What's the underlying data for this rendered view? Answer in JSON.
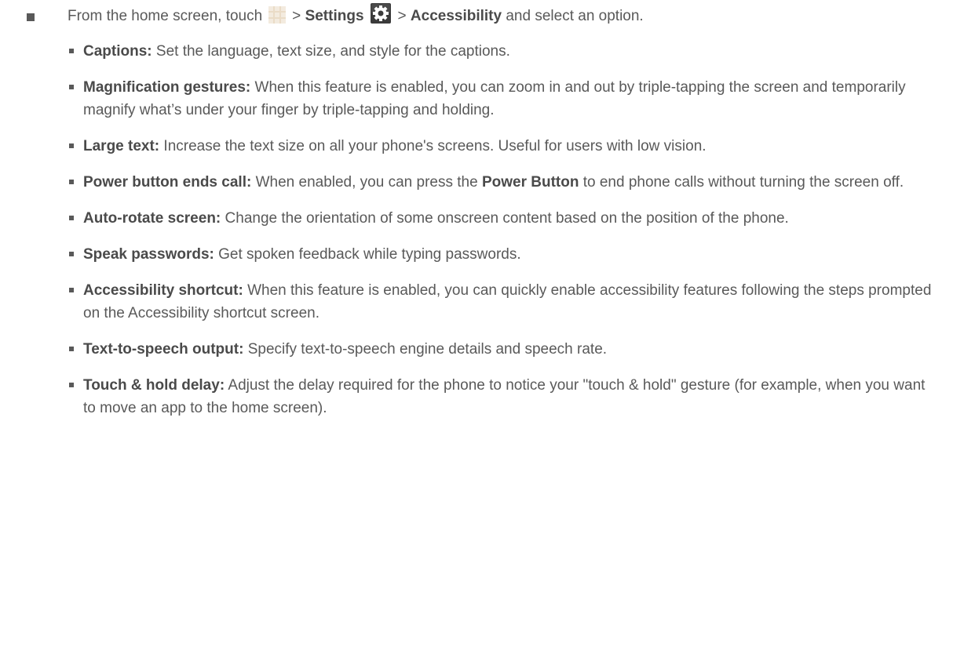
{
  "main_step": {
    "prefix": "From the home screen, touch",
    "sep1": ">",
    "settings": "Settings",
    "sep2": ">",
    "accessibility": "Accessibility",
    "suffix": "and select an option.",
    "apps_icon": "apps-grid-icon",
    "settings_icon": "gear-icon"
  },
  "items": [
    {
      "term": "Captions:",
      "desc": "Set the language, text size, and style for the captions."
    },
    {
      "term": "Magnification gestures:",
      "desc": "When this feature is enabled, you can zoom in and out by triple-tapping the screen and temporarily magnify what’s under your finger by triple-tapping and holding."
    },
    {
      "term": "Large text:",
      "desc": "Increase the text size on all your phone's screens. Useful for users with low vision."
    },
    {
      "term": "Power button ends call:",
      "desc_a": "When enabled, you can press the",
      "desc_bold": "Power Button",
      "desc_b": "to end phone calls without turning the screen off."
    },
    {
      "term": "Auto-rotate screen:",
      "desc": "Change the orientation of some onscreen content based on the position of the phone."
    },
    {
      "term": "Speak passwords:",
      "desc": "Get spoken feedback while typing passwords."
    },
    {
      "term": "Accessibility shortcut:",
      "desc": "When this feature is enabled, you can quickly enable accessibility features following the steps prompted on the Accessibility shortcut screen."
    },
    {
      "term": "Text-to-speech output:",
      "desc": "Specify text-to-speech engine details and speech rate."
    },
    {
      "term": "Touch & hold delay:",
      "desc": "Adjust the delay required for the phone to notice your \"touch & hold\" gesture (for example, when you want to move an app to the home screen)."
    }
  ],
  "colors": {
    "text": "#595959",
    "bold_text": "#4a4a4a",
    "apps_icon": "#e8d9c4",
    "settings_icon_bg": "#3a3a3a"
  }
}
